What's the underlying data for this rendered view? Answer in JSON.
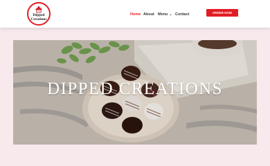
{
  "header": {
    "logo": {
      "line1": "Dipped",
      "line2": "Creations"
    },
    "nav": {
      "home": "Home",
      "about": "About",
      "menu": "Menu",
      "contact": "Contact"
    },
    "order_button": "ORDER NOW"
  },
  "hero": {
    "title": "DIPPED CREATIONS"
  },
  "colors": {
    "accent": "#e11d24",
    "page_background": "#f8e9ec"
  },
  "icons": {
    "menu_dropdown": "chevron-down-icon"
  }
}
